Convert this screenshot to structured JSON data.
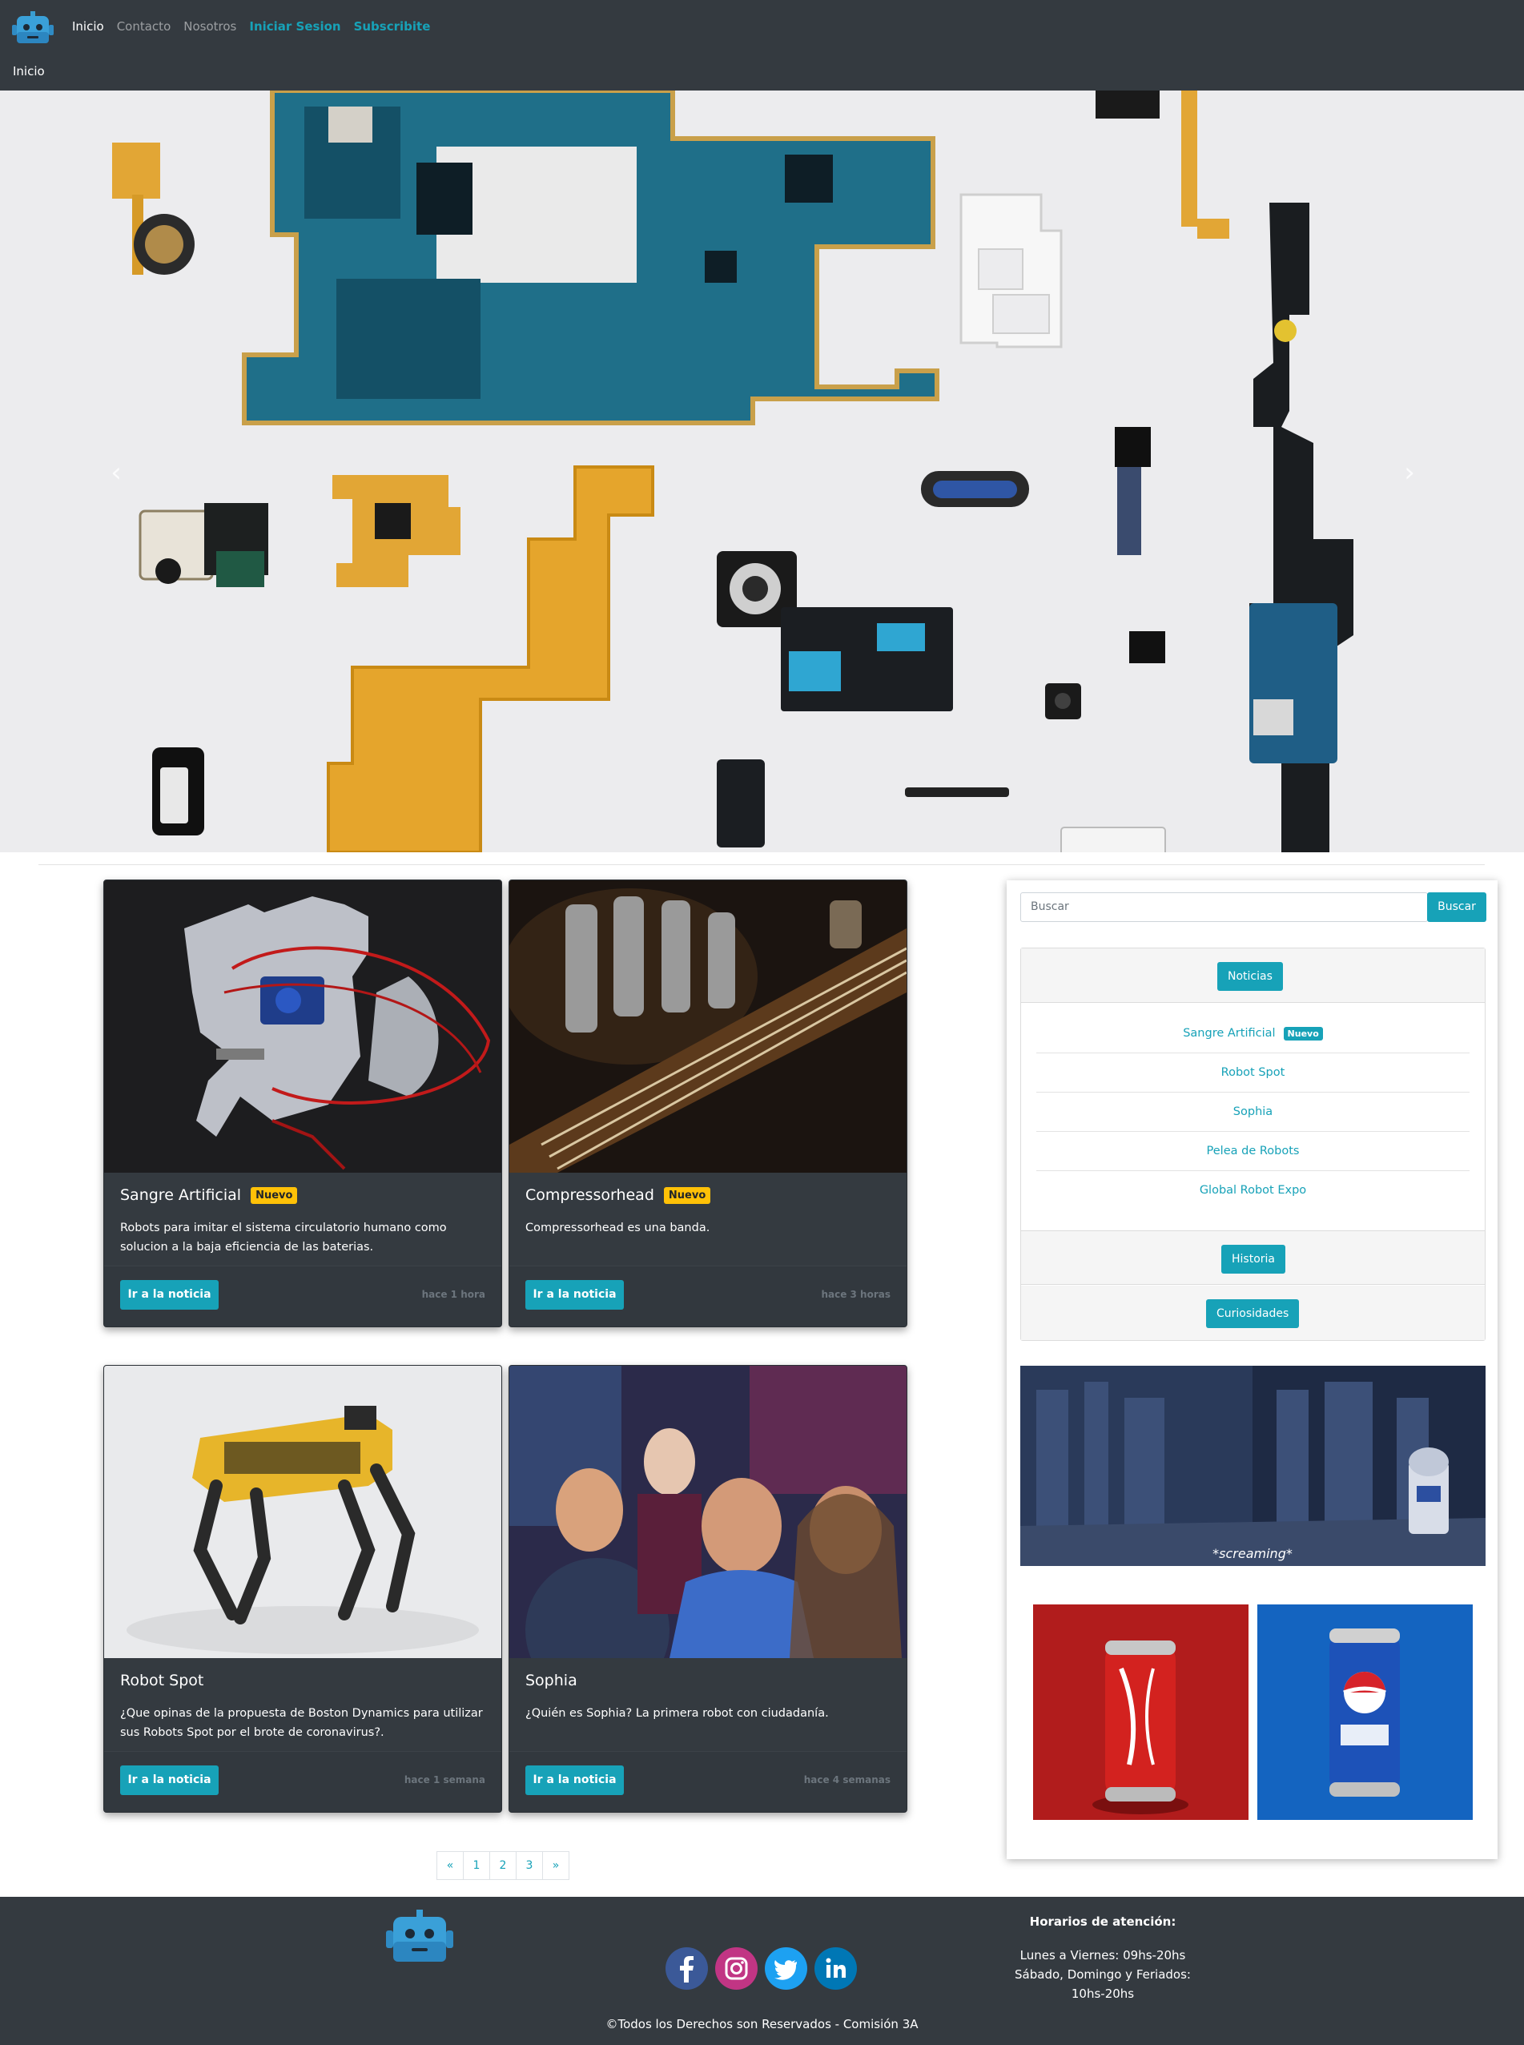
{
  "nav": {
    "links": [
      {
        "label": "Inicio"
      },
      {
        "label": "Contacto"
      },
      {
        "label": "Nosotros"
      },
      {
        "label": "Iniciar Sesion"
      },
      {
        "label": "Subscribite"
      }
    ],
    "breadcrumb": "Inicio"
  },
  "hero": {
    "prev_icon": "chevron-left-icon",
    "next_icon": "chevron-right-icon"
  },
  "cards": [
    {
      "title": "Sangre Artificial",
      "badge": "Nuevo",
      "text": "Robots para imitar el sistema circulatorio humano como solucion a la baja eficiencia de las baterias.",
      "button": "Ir a la noticia",
      "time": "hace 1 hora"
    },
    {
      "title": "Compressorhead",
      "badge": "Nuevo",
      "text": "Compressorhead es una banda.",
      "button": "Ir a la noticia",
      "time": "hace 3 horas"
    },
    {
      "title": "Robot Spot",
      "badge": "",
      "text": "¿Que opinas de la propuesta de Boston Dynamics para utilizar sus Robots Spot por el brote de coronavirus?.",
      "button": "Ir a la noticia",
      "time": "hace 1 semana"
    },
    {
      "title": "Sophia",
      "badge": "",
      "text": "¿Quién es Sophia? La primera robot con ciudadanía.",
      "button": "Ir a la noticia",
      "time": "hace 4 semanas"
    }
  ],
  "pagination": [
    "«",
    "1",
    "2",
    "3",
    "»"
  ],
  "sidebar": {
    "search_placeholder": "Buscar",
    "search_button": "Buscar",
    "sections": {
      "noticias": "Noticias",
      "historia": "Historia",
      "curiosidades": "Curiosidades"
    },
    "news": [
      {
        "label": "Sangre Artificial",
        "badge": "Nuevo"
      },
      {
        "label": "Robot Spot",
        "badge": ""
      },
      {
        "label": "Sophia",
        "badge": ""
      },
      {
        "label": "Pelea de Robots",
        "badge": ""
      },
      {
        "label": "Global Robot Expo",
        "badge": ""
      }
    ],
    "gif_caption": "*screaming*"
  },
  "footer": {
    "hours_title": "Horarios de atención:",
    "hours": [
      "Lunes a Viernes: 09hs-20hs",
      "Sábado, Domingo y Feriados:",
      "10hs-20hs"
    ],
    "copyright": "©Todos los Derechos son Reservados - Comisión 3A",
    "socials": [
      "facebook-icon",
      "instagram-icon",
      "twitter-icon",
      "linkedin-icon"
    ]
  },
  "colors": {
    "navbar": "#343a40",
    "accent": "#17a2b8",
    "badge": "#ffc107"
  }
}
